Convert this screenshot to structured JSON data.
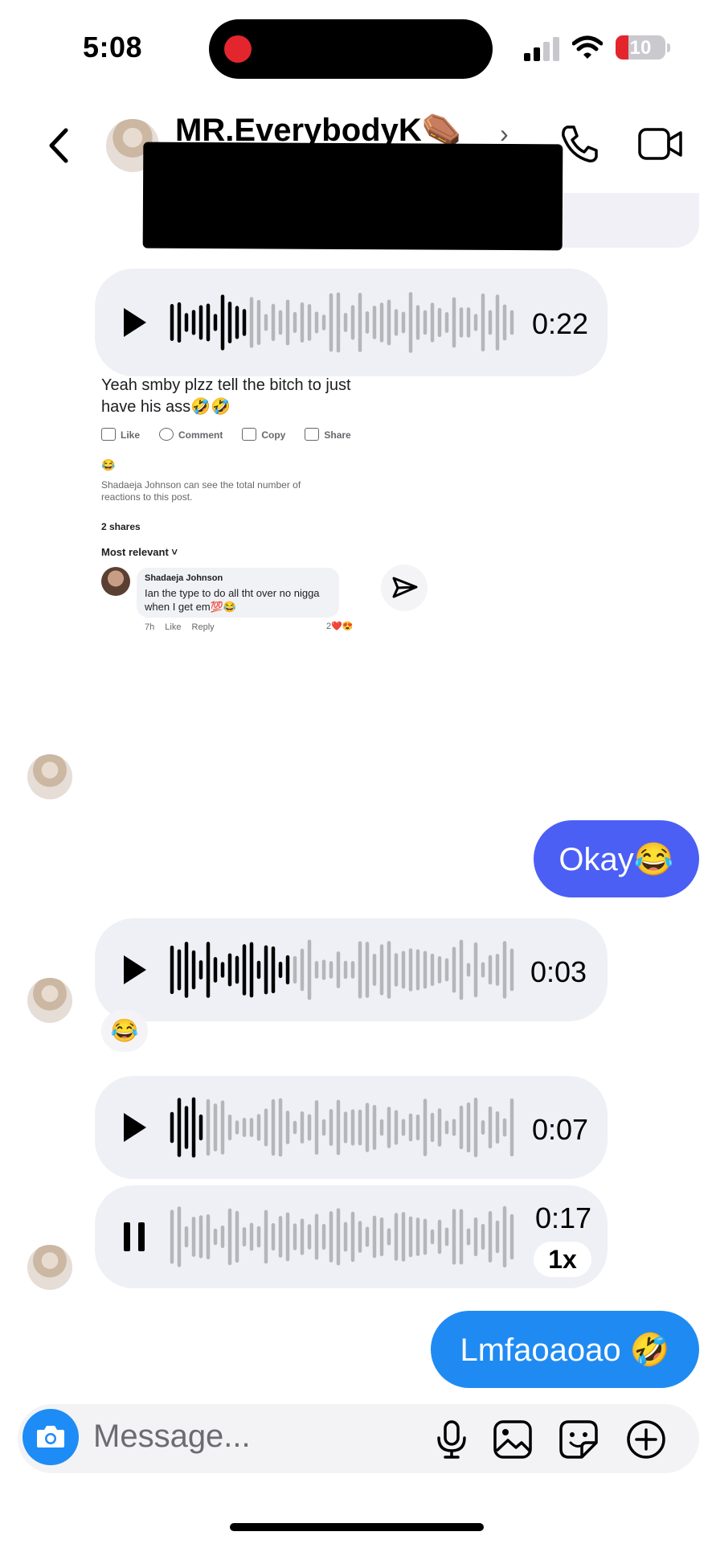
{
  "status": {
    "time": "5:08",
    "battery": "10"
  },
  "header": {
    "contact_name": "MR.EverybodyK⚰️",
    "chevron": "›"
  },
  "messages": {
    "voice1": {
      "duration": "0:22"
    },
    "voice2": {
      "duration": "0:03",
      "reaction": "😂"
    },
    "voice3": {
      "duration": "0:07"
    },
    "voice4": {
      "duration": "0:17",
      "speed": "1x"
    },
    "sent1": "Okay😂",
    "sent2": "Lmfaoaoao 🤣"
  },
  "fb_post": {
    "text": "Yeah smby plzz tell the bitch to just have his ass🤣🤣",
    "actions": [
      "Like",
      "Comment",
      "Copy",
      "Share"
    ],
    "reaction_emoji": "😂",
    "visibility_note": "Shadaeja Johnson can see the total number of reactions to this post.",
    "shares": "2 shares",
    "sort": "Most relevant ˅",
    "comment": {
      "author": "Shadaeja Johnson",
      "text": "Ian the type to do all tht over no nigga when I get em💯😂",
      "meta": "7h Like Reply",
      "reactions": "2❤️😍"
    }
  },
  "composer": {
    "placeholder": "Message..."
  },
  "icons": [
    "back-chevron-icon",
    "phone-icon",
    "video-camera-icon",
    "play-icon",
    "pause-icon",
    "camera-icon",
    "microphone-icon",
    "image-icon",
    "sticker-icon",
    "plus-circle-icon",
    "send-icon"
  ]
}
